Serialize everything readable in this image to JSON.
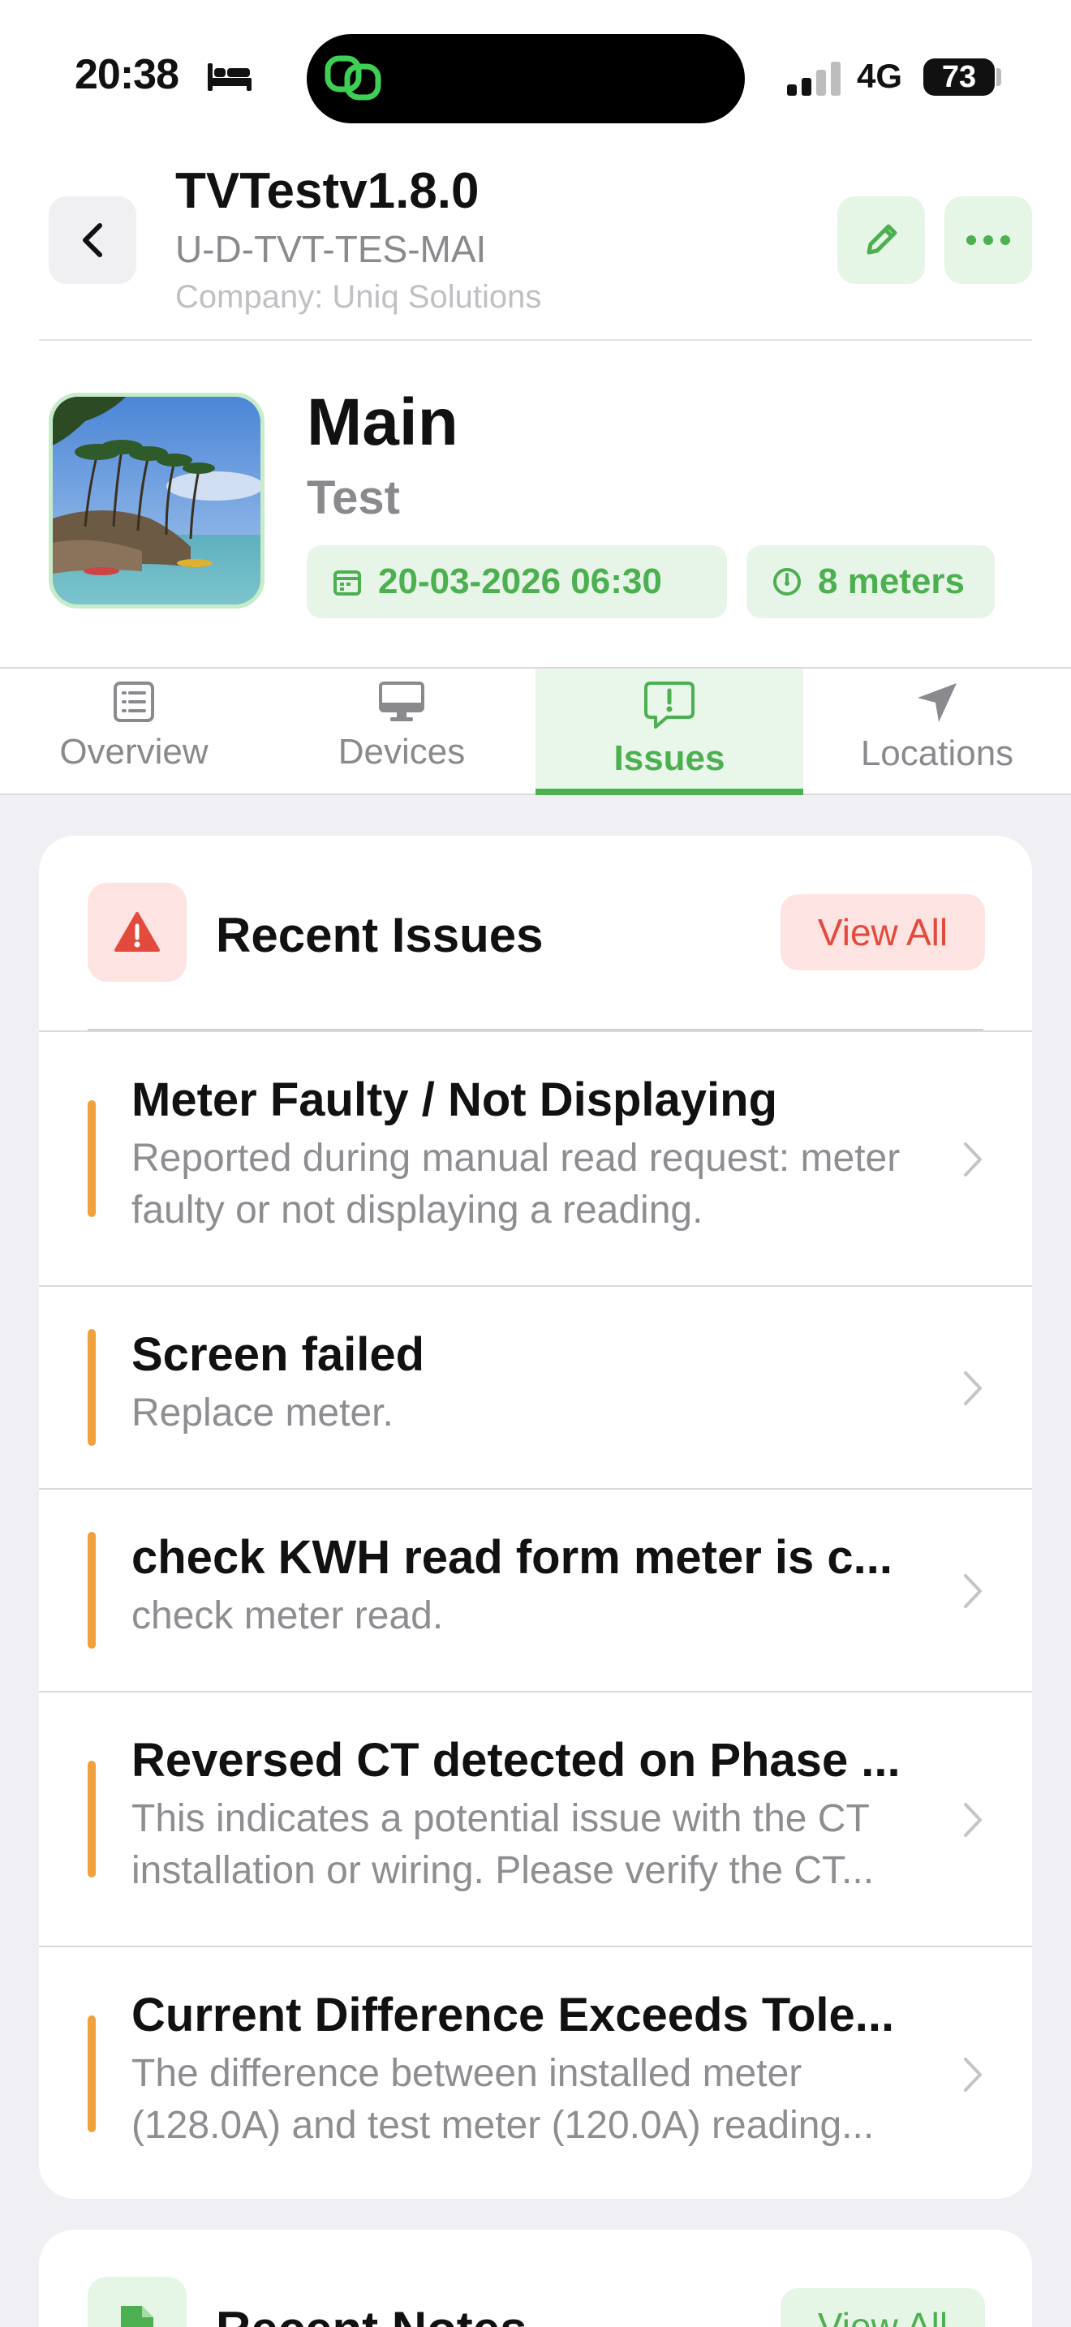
{
  "status_bar": {
    "time": "20:38",
    "network": "4G",
    "battery": "73"
  },
  "header": {
    "title": "TVTestv1.8.0",
    "code": "U-D-TVT-TES-MAI",
    "company": "Company: Uniq Solutions"
  },
  "location": {
    "name": "Main",
    "subtitle": "Test",
    "datetime": "20-03-2026 06:30",
    "meters": "8 meters"
  },
  "tabs": [
    {
      "label": "Overview",
      "icon": "list-icon",
      "active": false
    },
    {
      "label": "Devices",
      "icon": "monitor-icon",
      "active": false
    },
    {
      "label": "Issues",
      "icon": "alert-message-icon",
      "active": true
    },
    {
      "label": "Locations",
      "icon": "navigation-arrow-icon",
      "active": false
    }
  ],
  "issues_card": {
    "title": "Recent Issues",
    "view_all": "View All",
    "accent": "#e24a3b",
    "items": [
      {
        "title": "Meter Faulty / Not Displaying",
        "desc": "Reported during manual read request: meter faulty or not displaying a reading."
      },
      {
        "title": "Screen failed",
        "desc": "Replace meter."
      },
      {
        "title": "check KWH read form meter is c...",
        "desc": "check meter read."
      },
      {
        "title": "Reversed CT detected on Phase ...",
        "desc": "This indicates a potential issue with the CT installation or wiring. Please verify the CT..."
      },
      {
        "title": "Current Difference Exceeds Tole...",
        "desc": "The difference between installed meter (128.0A) and test meter (120.0A) reading..."
      }
    ],
    "severity_color": "#f0a03c"
  },
  "notes_card": {
    "title": "Recent Notes",
    "view_all": "View All"
  },
  "colors": {
    "brand_green": "#4caf50",
    "green_bg": "#e7f5e8",
    "danger": "#e24a3b"
  }
}
